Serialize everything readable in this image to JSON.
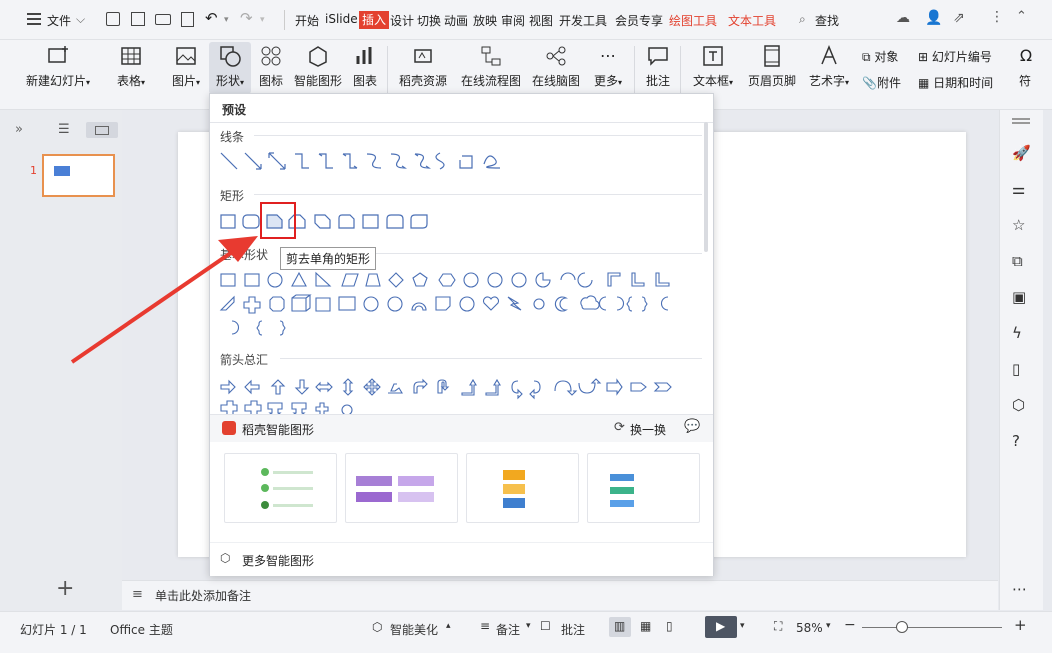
{
  "titlebar": {
    "file_menu": "文件",
    "tabs": [
      "开始",
      "iSlide",
      "插入",
      "设计",
      "切换",
      "动画",
      "放映",
      "审阅",
      "视图",
      "开发工具",
      "会员专享",
      "绘图工具",
      "文本工具"
    ],
    "search": "查找"
  },
  "ribbon": {
    "new_slide": "新建幻灯片",
    "table": "表格",
    "picture": "图片",
    "shape": "形状",
    "icon": "图标",
    "smart_graphic": "智能图形",
    "chart": "图表",
    "docer_res": "稻壳资源",
    "flowchart": "在线流程图",
    "mindmap": "在线脑图",
    "more": "更多",
    "comment": "批注",
    "textbox": "文本框",
    "header_footer": "页眉页脚",
    "wordart": "艺术字",
    "object": "对象",
    "attachment": "附件",
    "slide_number": "幻灯片编号",
    "datetime": "日期和时间",
    "symbol": "符"
  },
  "dropdown": {
    "preset": "预设",
    "lines": "线条",
    "rectangles": "矩形",
    "basic_shapes": "基本形状",
    "arrows": "箭头总汇",
    "tooltip": "剪去单角的矩形",
    "smart_section": "稻壳智能图形",
    "refresh": "换一换",
    "more_smart": "更多智能图形"
  },
  "leftpanel": {
    "slide_index": "1"
  },
  "notes": {
    "placeholder": "单击此处添加备注"
  },
  "status": {
    "slide_info": "幻灯片 1 / 1",
    "theme": "Office 主题",
    "beautify": "智能美化",
    "notes_btn": "备注",
    "comment_btn": "批注",
    "zoom": "58%"
  },
  "colors": {
    "accent": "#e3412f",
    "shape_stroke": "#4a6fb5",
    "highlight_box": "#e02020",
    "arrow": "#e83a30",
    "thumb_blue": "#4a7fd6"
  }
}
